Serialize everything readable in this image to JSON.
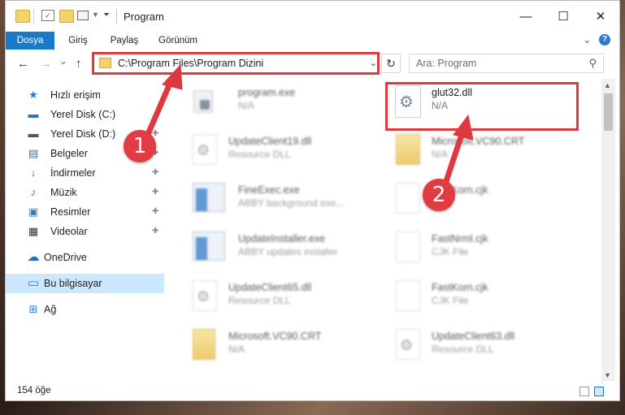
{
  "window": {
    "title": "Program",
    "minimize_glyph": "—",
    "maximize_glyph": "☐",
    "close_glyph": "✕"
  },
  "ribbon": {
    "tabs": [
      "Dosya",
      "Giriş",
      "Paylaş",
      "Görünüm"
    ],
    "collapse_glyph": "⌄",
    "help_glyph": "?"
  },
  "nav": {
    "back": "←",
    "forward": "→",
    "recent": "⌄",
    "up": "↑"
  },
  "address": {
    "path": "C:\\Program Files\\Program Dizini",
    "dropdown_glyph": "⌄",
    "refresh_glyph": "↻"
  },
  "search": {
    "placeholder": "Ara: Program",
    "icon_glyph": "⚲"
  },
  "sidebar": {
    "items": [
      {
        "label": "Hızlı erişim",
        "icon": "star-icon",
        "glyph": "★",
        "color": "#2b79d0"
      },
      {
        "label": "Yerel Disk (C:)",
        "icon": "drive-icon",
        "glyph": "▬",
        "color": "#2f6fc2",
        "pinned": true
      },
      {
        "label": "Yerel Disk (D:)",
        "icon": "drive-icon",
        "glyph": "▬",
        "color": "#555555",
        "pinned": true
      },
      {
        "label": "Belgeler",
        "icon": "documents-icon",
        "glyph": "▤",
        "color": "#4a6a8a",
        "pinned": true
      },
      {
        "label": "İndirmeler",
        "icon": "download-icon",
        "glyph": "↓",
        "color": "#2b79d0",
        "pinned": true
      },
      {
        "label": "Müzik",
        "icon": "music-icon",
        "glyph": "♪",
        "color": "#2b79d0",
        "pinned": true
      },
      {
        "label": "Resimler",
        "icon": "pictures-icon",
        "glyph": "▣",
        "color": "#3a7ab8",
        "pinned": true
      },
      {
        "label": "Videolar",
        "icon": "video-icon",
        "glyph": "▦",
        "color": "#333333",
        "pinned": true
      },
      {
        "label": "OneDrive",
        "icon": "cloud-icon",
        "glyph": "☁",
        "color": "#1e6fc4"
      },
      {
        "label": "Bu bilgisayar",
        "icon": "computer-icon",
        "glyph": "▭",
        "color": "#2b79d0"
      },
      {
        "label": "Ağ",
        "icon": "network-icon",
        "glyph": "⊞",
        "color": "#2b79d0"
      }
    ],
    "pin_glyph": "✚"
  },
  "files": [
    {
      "name": "program.exe",
      "desc": "N/A",
      "kind": "exe"
    },
    {
      "name": "glut32.dll",
      "desc": "N/A",
      "kind": "dll"
    },
    {
      "name": "UpdateClient19.dll",
      "desc": "Resource DLL",
      "kind": "dll"
    },
    {
      "name": "Microsoft.VC90.CRT",
      "desc": "N/A",
      "kind": "folder"
    },
    {
      "name": "FineExec.exe",
      "desc": "ABBY background exe...",
      "kind": "app"
    },
    {
      "name": "FastKorn.cjk",
      "desc": "",
      "kind": "page"
    },
    {
      "name": "UpdateInstaller.exe",
      "desc": "ABBY updates installer",
      "kind": "app"
    },
    {
      "name": "FastNrml.cjk",
      "desc": "CJK File",
      "kind": "page"
    },
    {
      "name": "UpdateClient65.dll",
      "desc": "Resource DLL",
      "kind": "dll"
    },
    {
      "name": "FastKorn.cjk",
      "desc": "CJK File",
      "kind": "page"
    },
    {
      "name": "Microsoft.VC90.CRT",
      "desc": "N/A",
      "kind": "folder"
    },
    {
      "name": "UpdateClient63.dll",
      "desc": "Resource DLL",
      "kind": "dll"
    }
  ],
  "status": {
    "count": "154 öğe"
  },
  "annotations": {
    "badge1": "1",
    "badge2": "2",
    "color": "#e0383f"
  },
  "scroll": {
    "up": "▲",
    "down": "▼"
  }
}
